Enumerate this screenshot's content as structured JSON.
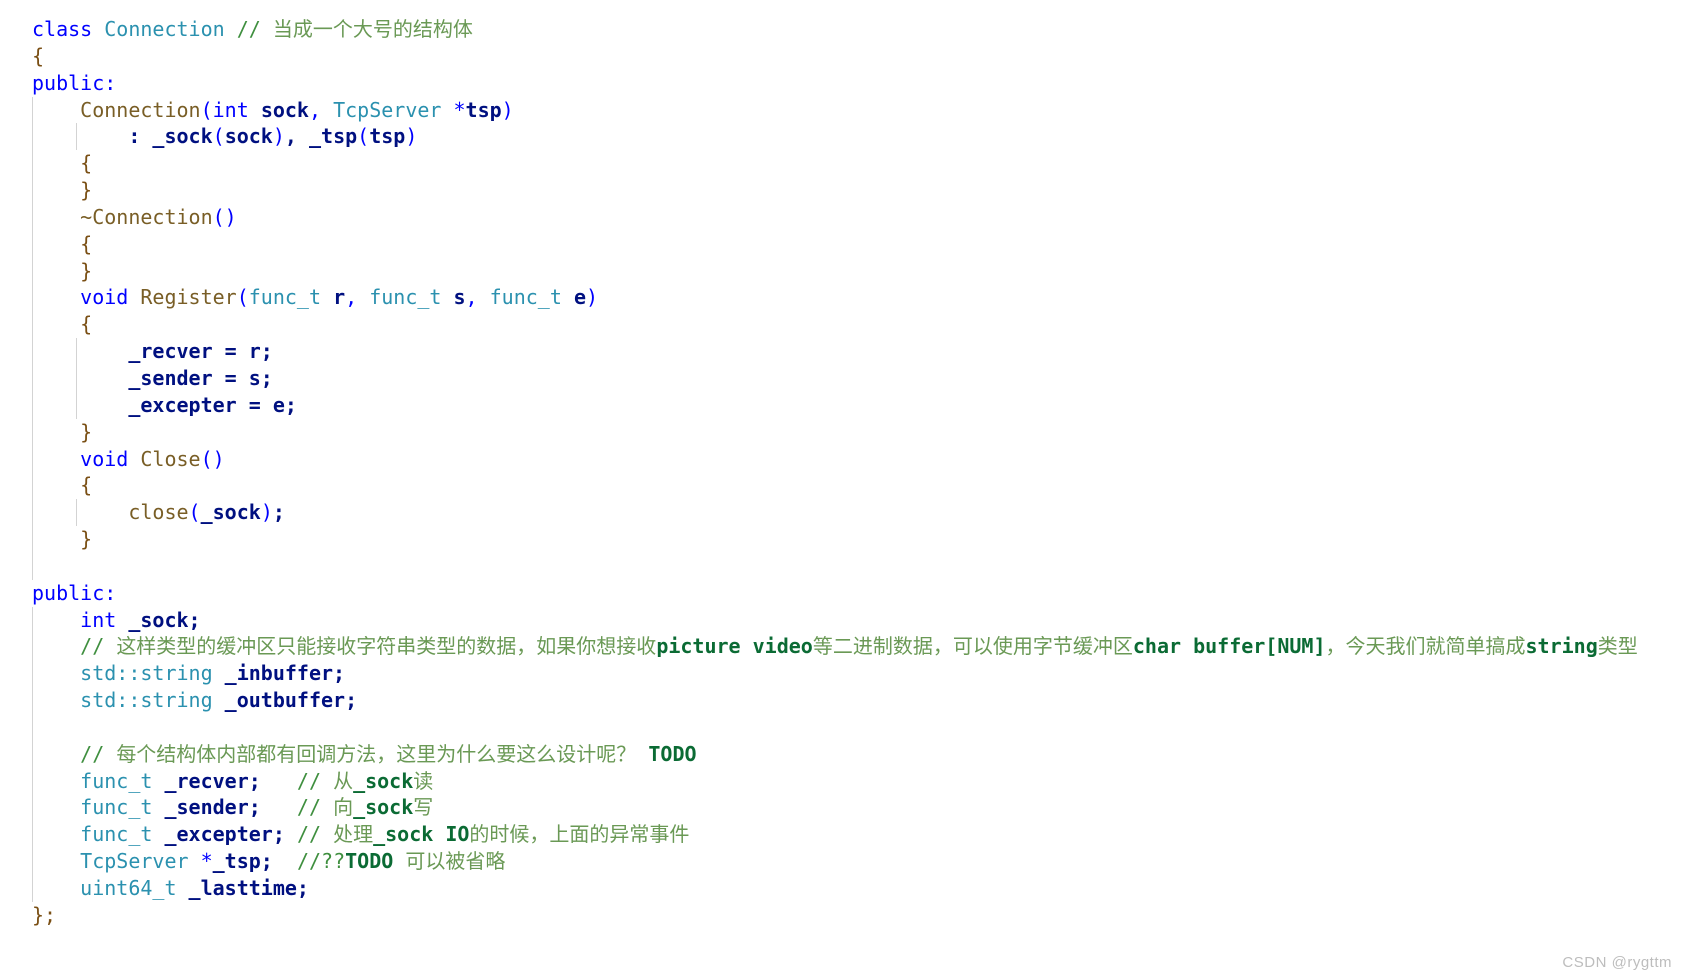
{
  "editor": {
    "language": "C++",
    "theme": "light",
    "background_color": "#ffffff",
    "font_size_px": 20,
    "line_height_px": 26.85,
    "indent_guides": true,
    "indent_guide_color": "#d3d3d3"
  },
  "colors": {
    "keyword": "#0000ff",
    "type": "#2b91af",
    "function": "#795e26",
    "brace": "#7a4f14",
    "variable": "#001080",
    "comment": "#3f8f3f",
    "comment_cjk": "#6a9955",
    "comment_code": "#0b6b34",
    "watermark": "#bdbdbd"
  },
  "watermark": {
    "text": "CSDN @rygttm"
  },
  "code": {
    "line_01": {
      "kw": "class",
      "type": "Connection",
      "comment_slashes": "//",
      "comment_cjk": "当成一个大号的结构体"
    },
    "line_02": {
      "brace": "{"
    },
    "line_03": {
      "kw": "public:"
    },
    "line_04": {
      "fn": "Connection",
      "open": "(",
      "kw": "int",
      "p1": "sock",
      "comma": ", ",
      "type": "TcpServer",
      "star": "*",
      "p2": "tsp",
      "close": ")"
    },
    "line_05": {
      "colon": ": ",
      "m1": "_sock",
      "o1": "(",
      "a1": "sock",
      "c1": ")",
      "comma": ", ",
      "m2": "_tsp",
      "o2": "(",
      "a2": "tsp",
      "c2": ")"
    },
    "line_06": {
      "brace": "{"
    },
    "line_07": {
      "brace": "}"
    },
    "line_08": {
      "fn": "~Connection",
      "parens": "()"
    },
    "line_09": {
      "brace": "{"
    },
    "line_10": {
      "brace": "}"
    },
    "line_11": {
      "kw": "void",
      "fn": "Register",
      "open": "(",
      "t1": "func_t",
      "a1": "r",
      "c1": ", ",
      "t2": "func_t",
      "a2": "s",
      "c2": ", ",
      "t3": "func_t",
      "a3": "e",
      "close": ")"
    },
    "line_12": {
      "brace": "{"
    },
    "line_13": {
      "lhs": "_recver",
      "op": " = ",
      "rhs": "r;"
    },
    "line_14": {
      "lhs": "_sender",
      "op": " = ",
      "rhs": "s;"
    },
    "line_15": {
      "lhs": "_excepter",
      "op": " = ",
      "rhs": "e;"
    },
    "line_16": {
      "brace": "}"
    },
    "line_17": {
      "kw": "void",
      "fn": "Close",
      "parens": "()"
    },
    "line_18": {
      "brace": "{"
    },
    "line_19": {
      "fn": "close",
      "open": "(",
      "arg": "_sock",
      "close": ")",
      "semi": ";"
    },
    "line_20": {
      "brace": "}"
    },
    "line_21": {
      "blank": ""
    },
    "line_22": {
      "kw": "public:"
    },
    "line_23": {
      "kw": "int",
      "var": "_sock;"
    },
    "line_24": {
      "slashes": "//",
      "seg1": "这样类型的缓冲区只能接收字符串类型的数据，如果你想接收",
      "code1": "picture video",
      "seg2": "等二进制数据，可以使用字节缓冲区",
      "code2": "char buffer[NUM]",
      "seg3": "，今天我们就简单搞成",
      "code3": "string",
      "seg4": "类型"
    },
    "line_25": {
      "type": "std::string",
      "var": "_inbuffer;"
    },
    "line_26": {
      "type": "std::string",
      "var": "_outbuffer;"
    },
    "line_27": {
      "blank": ""
    },
    "line_28": {
      "slashes": "//",
      "cjk": "每个结构体内部都有回调方法，这里为什么要这么设计呢？",
      "code": "TODO"
    },
    "line_29": {
      "type": "func_t",
      "var": "_recver;",
      "slashes": "//",
      "cjk1": "从",
      "code": "_sock",
      "cjk2": "读"
    },
    "line_30": {
      "type": "func_t",
      "var": "_sender;",
      "slashes": "//",
      "cjk1": "向",
      "code": "_sock",
      "cjk2": "写"
    },
    "line_31": {
      "type": "func_t",
      "var": "_excepter;",
      "slashes": "//",
      "cjk1": "处理",
      "code": "_sock IO",
      "cjk2": "的时候，上面的异常事件"
    },
    "line_32": {
      "type": "TcpServer",
      "star": "*",
      "var": "_tsp;",
      "slashes": "//??",
      "code": "TODO",
      "cjk": "可以被省略"
    },
    "line_33": {
      "type": "uint64_t",
      "var": "_lasttime;"
    },
    "line_34": {
      "brace": "};"
    }
  }
}
